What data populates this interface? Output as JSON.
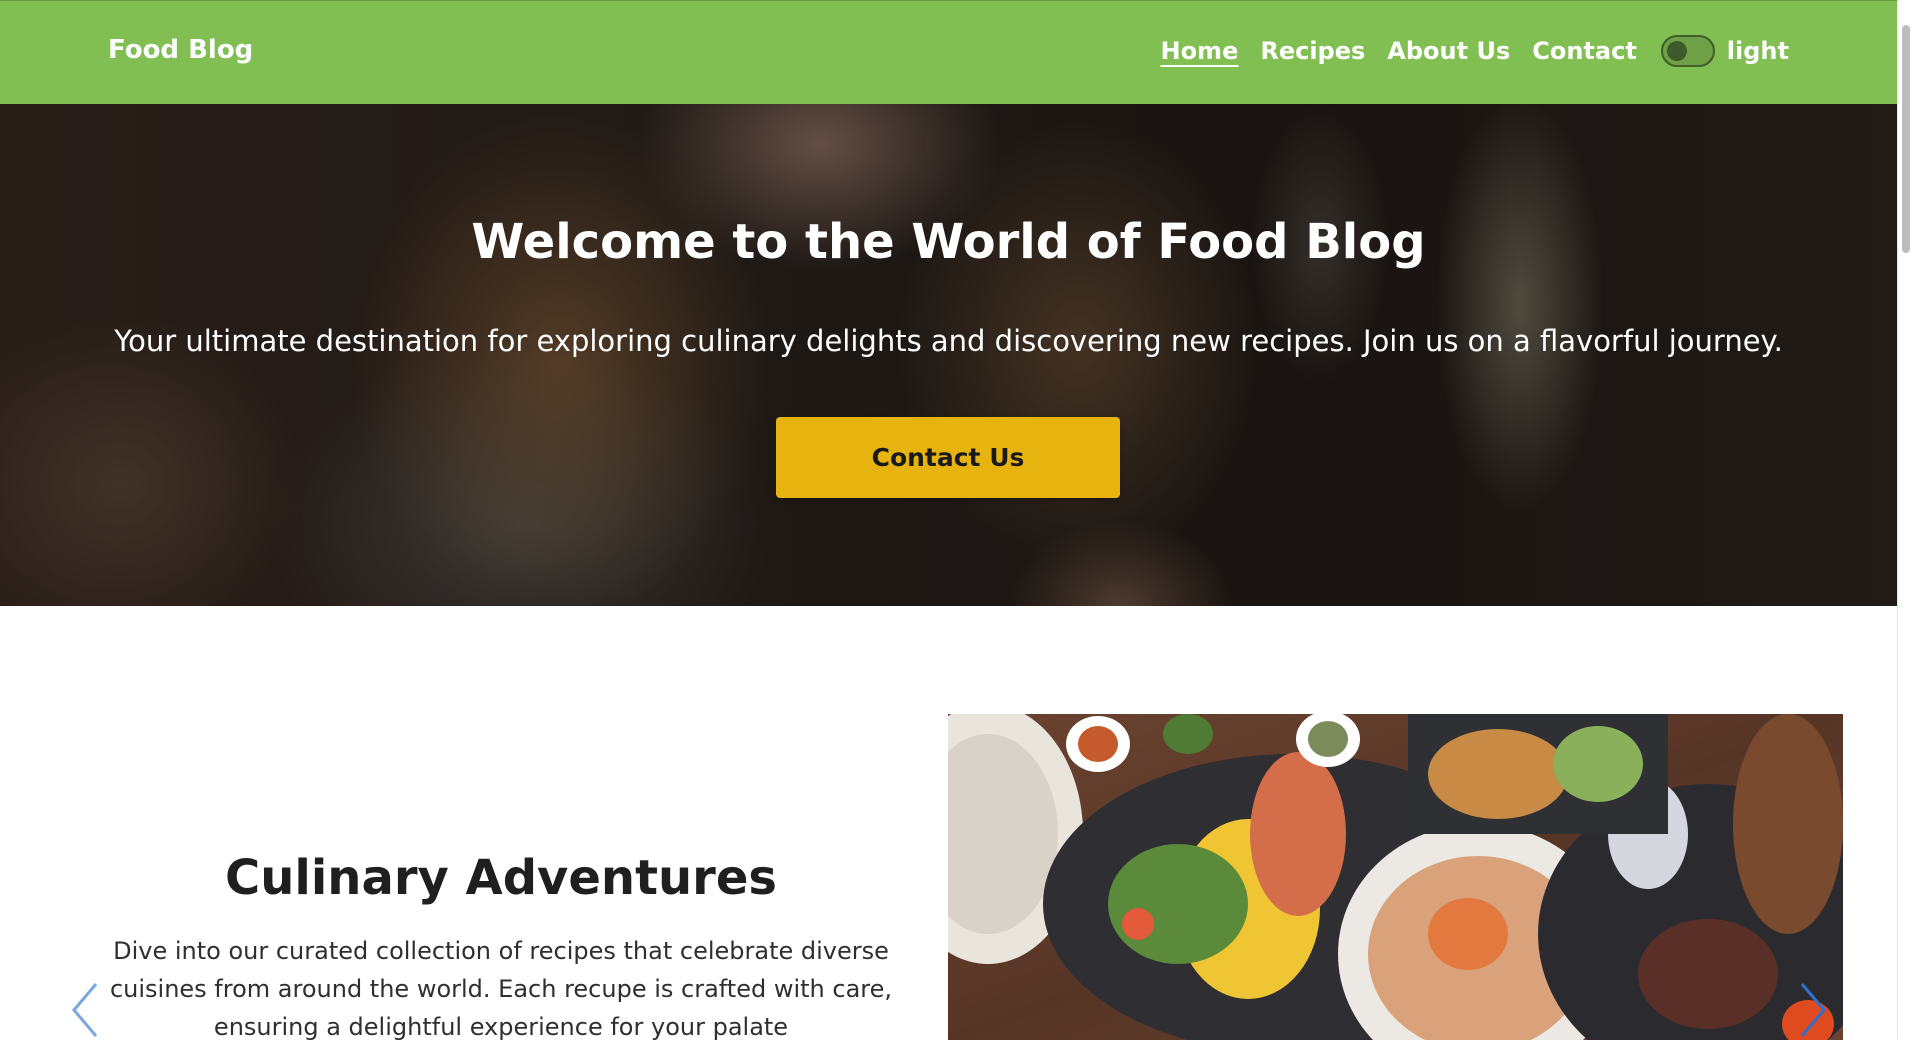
{
  "nav": {
    "brand": "Food Blog",
    "links": [
      {
        "label": "Home",
        "active": true
      },
      {
        "label": "Recipes",
        "active": false
      },
      {
        "label": "About Us",
        "active": false
      },
      {
        "label": "Contact",
        "active": false
      }
    ],
    "theme_toggle": {
      "label": "light",
      "state": "off"
    }
  },
  "hero": {
    "title": "Welcome to the World of Food Blog",
    "subtitle": "Your ultimate destination for exploring culinary delights and discovering new recipes. Join us on a flavorful journey.",
    "button_label": "Contact Us"
  },
  "feature": {
    "title": "Culinary Adventures",
    "text": "Dive into our curated collection of recipes that celebrate diverse cuisines from around the world. Each recupe is crafted with care, ensuring a delightful experience for your palate"
  },
  "colors": {
    "nav_bg": "#81bf53",
    "button_bg": "#e7b40f",
    "arrow": "#7aa7e0",
    "arrow_dark": "#2f6fd0"
  },
  "icons": {
    "carousel_prev": "chevron-left-icon",
    "carousel_next": "chevron-right-icon"
  }
}
